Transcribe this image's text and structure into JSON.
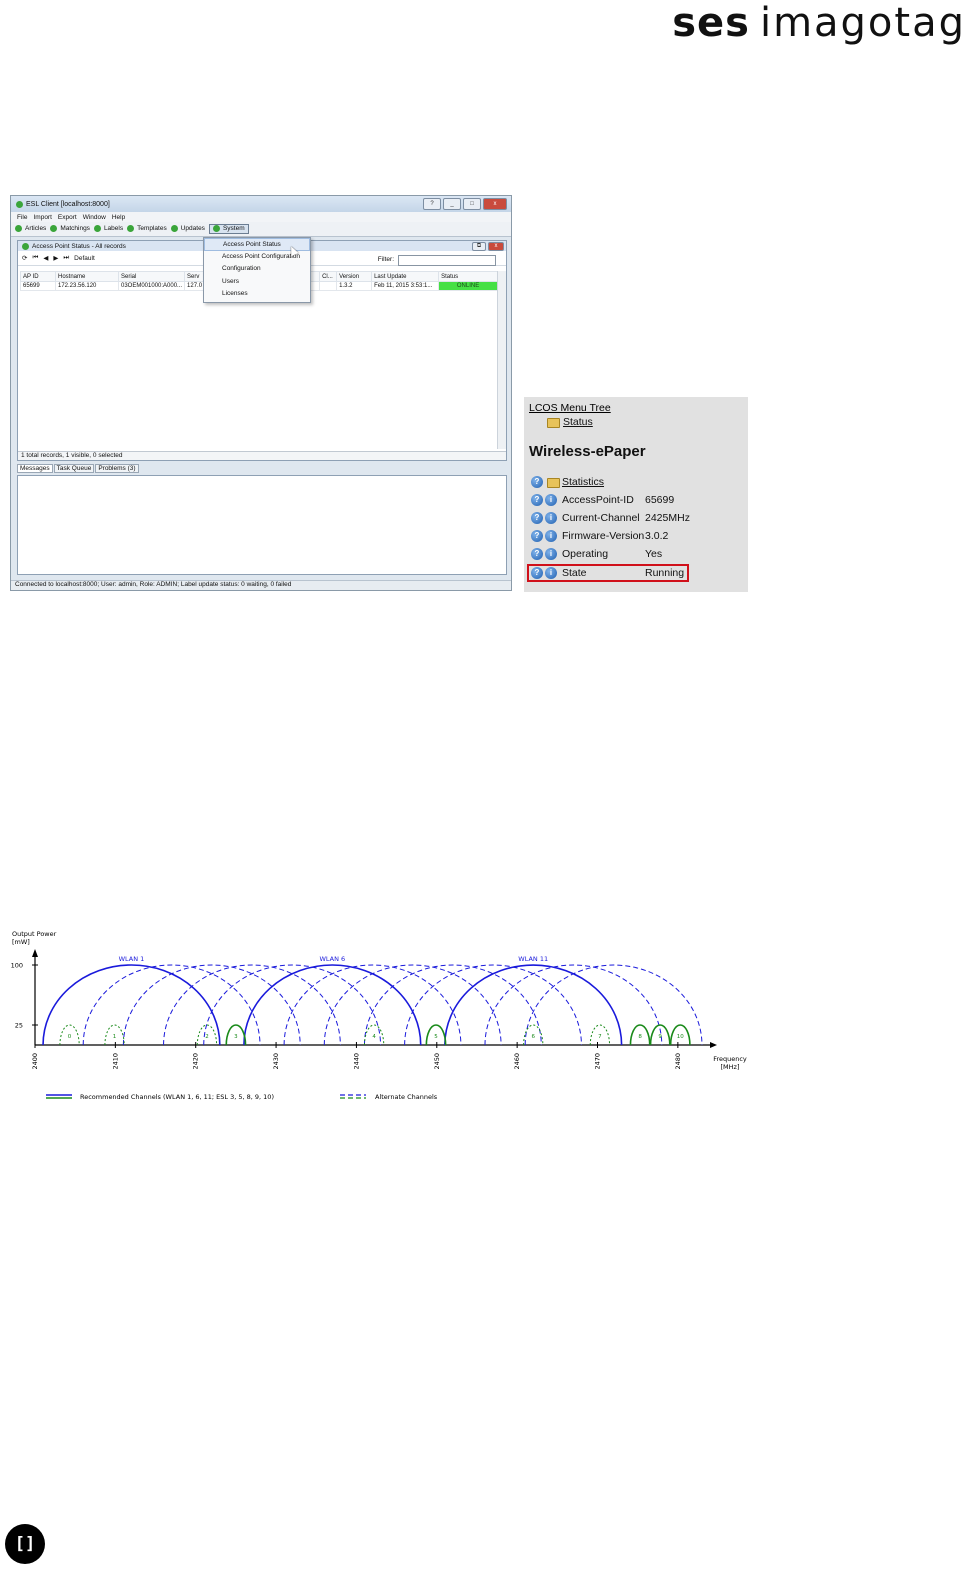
{
  "brand": {
    "bold": "ses",
    "light": "imagotag"
  },
  "esl_window": {
    "title": "ESL Client [localhost:8000]",
    "menu": [
      "File",
      "Import",
      "Export",
      "Window",
      "Help"
    ],
    "tabs": [
      "Articles",
      "Matchings",
      "Labels",
      "Templates",
      "Updates",
      "System"
    ],
    "inner_title": "Access Point Status - All records",
    "toolbar_default": "Default",
    "filter_label": "Filter:",
    "table": {
      "headers": [
        "AP ID",
        "Hostname",
        "Serial",
        "Serv",
        "",
        "Cl...",
        "Version",
        "Last Update",
        "Status"
      ],
      "rows": [
        [
          "65699",
          "172.23.56.120",
          "03OEM001000:A000...",
          "127.0",
          "",
          "",
          "1.3.2",
          "Feb 11, 2015 3:53:1...",
          "ONLINE"
        ]
      ]
    },
    "records_status": "1 total records, 1 visible, 0 selected",
    "lower_tabs": [
      "Messages",
      "Task Queue",
      "Problems (3)"
    ],
    "bottom_status": "Connected to localhost:8000; User: admin, Role: ADMIN; Label update status: 0 waiting, 0 failed"
  },
  "dropdown": {
    "items": [
      "Access Point Status",
      "Access Point Configuration",
      "Configuration",
      "Users",
      "Licenses"
    ],
    "highlighted_index": 0
  },
  "lcos": {
    "tree_link": "LCOS Menu Tree",
    "status_link": "Status",
    "heading": "Wireless-ePaper",
    "statistics": "Statistics",
    "rows": [
      {
        "label": "AccessPoint-ID",
        "value": "65699"
      },
      {
        "label": "Current-Channel",
        "value": "2425MHz"
      },
      {
        "label": "Firmware-Version",
        "value": "3.0.2"
      },
      {
        "label": "Operating",
        "value": "Yes"
      },
      {
        "label": "State",
        "value": "Running"
      }
    ],
    "highlight_color": "#d0101a"
  },
  "chart_data": {
    "type": "area",
    "ylabel": "Output Power\n[mW]",
    "xlabel": "Frequency\n[MHz]",
    "x_ticks": [
      2400,
      2410,
      2420,
      2430,
      2440,
      2450,
      2460,
      2470,
      2480
    ],
    "y_ticks": [
      25,
      100
    ],
    "xlim": [
      2400,
      2484
    ],
    "ylim": [
      0,
      110
    ],
    "wlan_series": [
      {
        "name": "WLAN 1",
        "center": 2412,
        "peak": 100,
        "style": "solid"
      },
      {
        "name": "",
        "center": 2417,
        "peak": 100,
        "style": "dashed"
      },
      {
        "name": "",
        "center": 2422,
        "peak": 100,
        "style": "dashed"
      },
      {
        "name": "",
        "center": 2427,
        "peak": 100,
        "style": "dashed"
      },
      {
        "name": "",
        "center": 2432,
        "peak": 100,
        "style": "dashed"
      },
      {
        "name": "WLAN 6",
        "center": 2437,
        "peak": 100,
        "style": "solid"
      },
      {
        "name": "",
        "center": 2442,
        "peak": 100,
        "style": "dashed"
      },
      {
        "name": "",
        "center": 2447,
        "peak": 100,
        "style": "dashed"
      },
      {
        "name": "",
        "center": 2452,
        "peak": 100,
        "style": "dashed"
      },
      {
        "name": "",
        "center": 2457,
        "peak": 100,
        "style": "dashed"
      },
      {
        "name": "WLAN 11",
        "center": 2462,
        "peak": 100,
        "style": "solid"
      },
      {
        "name": "",
        "center": 2467,
        "peak": 100,
        "style": "dashed"
      },
      {
        "name": "",
        "center": 2472,
        "peak": 100,
        "style": "dashed"
      }
    ],
    "esl_channels": [
      {
        "label": "0",
        "center": 2404.3,
        "style": "dashed"
      },
      {
        "label": "1",
        "center": 2409.9,
        "style": "dashed"
      },
      {
        "label": "2",
        "center": 2421.4,
        "style": "dashed"
      },
      {
        "label": "3",
        "center": 2425.0,
        "style": "solid"
      },
      {
        "label": "4",
        "center": 2442.2,
        "style": "dashed"
      },
      {
        "label": "5",
        "center": 2449.9,
        "style": "solid"
      },
      {
        "label": "6",
        "center": 2462.0,
        "style": "dashed"
      },
      {
        "label": "7",
        "center": 2470.3,
        "style": "dashed"
      },
      {
        "label": "8",
        "center": 2475.3,
        "style": "solid"
      },
      {
        "label": "9",
        "center": 2477.8,
        "style": "solid"
      },
      {
        "label": "10",
        "center": 2480.3,
        "style": "solid"
      }
    ],
    "legend": {
      "solid": "Recommended Channels (WLAN 1, 6, 11; ESL 3, 5, 8, 9, 10)",
      "dashed": "Alternate Channels"
    },
    "colors": {
      "wlan": "#1a1adb",
      "esl": "#1a8a1a"
    }
  },
  "footer_mark": "[]"
}
